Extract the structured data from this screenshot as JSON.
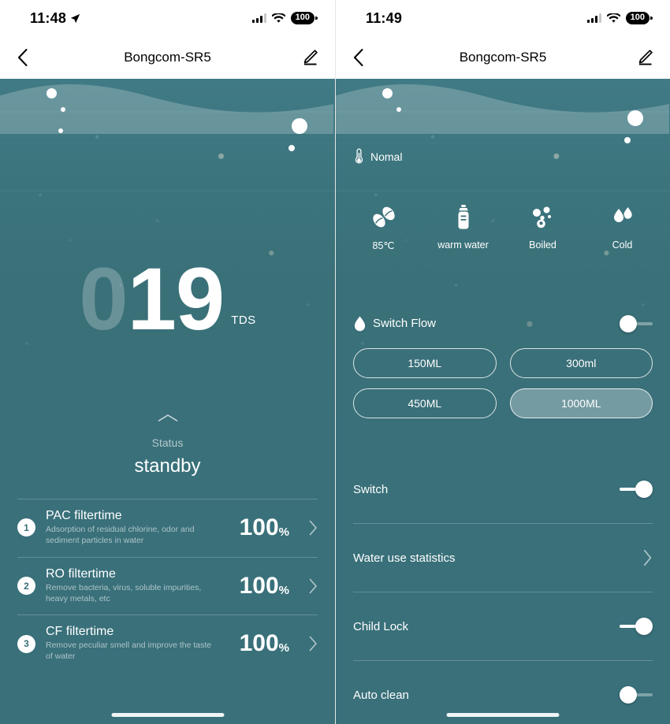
{
  "left": {
    "status_bar": {
      "time": "11:48",
      "battery": "100",
      "location_icon": "location-arrow-icon",
      "wifi_icon": "wifi-icon",
      "signal_icon": "cellular-signal-icon"
    },
    "nav": {
      "title": "Bongcom-SR5",
      "back_icon": "chevron-left-icon",
      "edit_icon": "pencil-edit-icon"
    },
    "tds": {
      "dim_digits": "0",
      "value": "19",
      "unit": "TDS"
    },
    "status": {
      "chevron_icon": "chevron-up-icon",
      "label": "Status",
      "value": "standby"
    },
    "filters": [
      {
        "num": "1",
        "title": "PAC filtertime",
        "desc": "Adsorption of residual chlorine, odor and sediment particles in water",
        "percent": "100",
        "percent_sign": "%",
        "chevron_icon": "chevron-right-icon"
      },
      {
        "num": "2",
        "title": "RO filtertime",
        "desc": "Remove bacteria, virus, soluble impurities, heavy metals, etc",
        "percent": "100",
        "percent_sign": "%",
        "chevron_icon": "chevron-right-icon"
      },
      {
        "num": "3",
        "title": "CF filtertime",
        "desc": "Remove peculiar smell and improve the taste of water",
        "percent": "100",
        "percent_sign": "%",
        "chevron_icon": "chevron-right-icon"
      }
    ]
  },
  "right": {
    "status_bar": {
      "time": "11:49",
      "battery": "100",
      "wifi_icon": "wifi-icon",
      "signal_icon": "cellular-signal-icon"
    },
    "nav": {
      "title": "Bongcom-SR5",
      "back_icon": "chevron-left-icon",
      "edit_icon": "pencil-edit-icon"
    },
    "mode_header": {
      "icon": "thermometer-icon",
      "label": "Nomal"
    },
    "modes": [
      {
        "icon": "coffee-beans-icon",
        "label": "85℃"
      },
      {
        "icon": "baby-bottle-icon",
        "label": "warm water"
      },
      {
        "icon": "bubbles-icon",
        "label": "Boiled"
      },
      {
        "icon": "water-drops-icon",
        "label": "Cold"
      }
    ],
    "switch_flow": {
      "icon": "water-drop-icon",
      "label": "Switch Flow",
      "enabled": false
    },
    "volumes": [
      {
        "label": "150ML",
        "selected": false
      },
      {
        "label": "300ml",
        "selected": false
      },
      {
        "label": "450ML",
        "selected": false
      },
      {
        "label": "1000ML",
        "selected": true
      }
    ],
    "settings": [
      {
        "label": "Switch",
        "control": "toggle",
        "enabled": true
      },
      {
        "label": "Water use statistics",
        "control": "chevron",
        "chevron_icon": "chevron-right-icon"
      },
      {
        "label": "Child Lock",
        "control": "toggle",
        "enabled": true
      },
      {
        "label": "Auto clean",
        "control": "toggle",
        "enabled": false
      }
    ]
  },
  "colors": {
    "water_teal": "#3a7078",
    "water_teal_light": "#407a84",
    "accent_white": "#ffffff"
  }
}
